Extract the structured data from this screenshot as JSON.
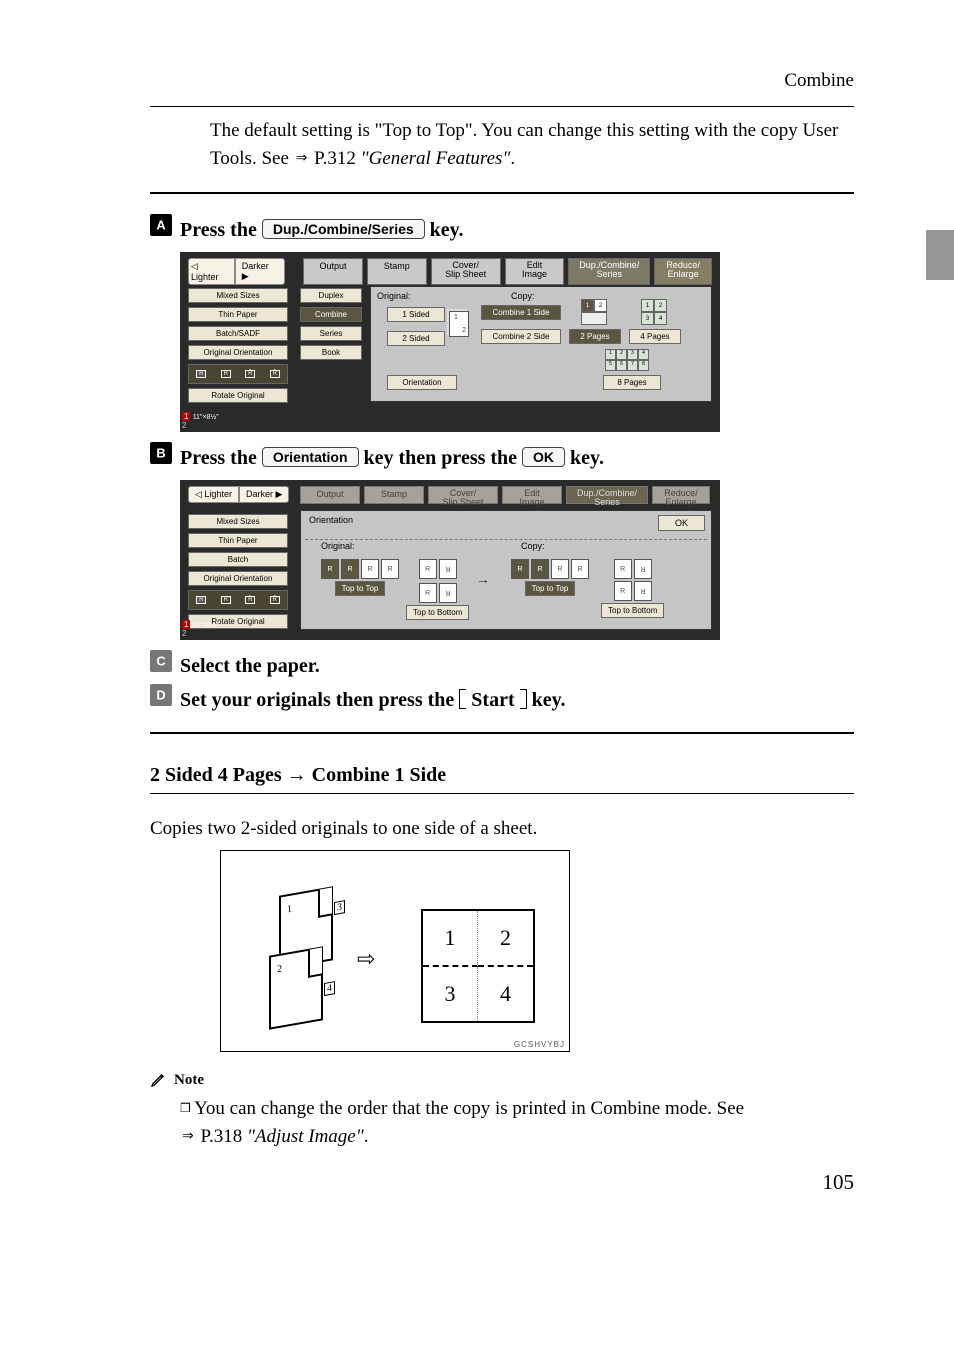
{
  "header_right": "Combine",
  "top_note": {
    "line1": "The default setting is \"Top to Top\". You can change this setting with the copy User Tools. See ",
    "ref_token": "⇒",
    "line1_after": " P.312 ",
    "line1_italic": "\"General Features\"",
    "line1_end": "."
  },
  "steps_stage1": {
    "a_pre": "Press the ",
    "a_btn": "Dup./Combine/Series",
    "a_post": " key.",
    "b_pre": "Press the ",
    "b_btn": "Orientation",
    "b_mid": " key then press the ",
    "b_btn2": "OK",
    "b_post": " key."
  },
  "ss1": {
    "lighter": "Lighter",
    "darker": "Darker",
    "row": {
      "output": "Output",
      "stamp": "Stamp",
      "cover": "Cover/\nSlip Sheet",
      "edit": "Edit\nImage",
      "dcs": "Dup./Combine/\nSeries",
      "reduce": "Reduce/\nEnlarge"
    },
    "left": {
      "mixed": "Mixed Sizes",
      "thin": "Thin Paper",
      "batch": "Batch/SADF",
      "orig": "Original Orientation",
      "rotate": "Rotate Original"
    },
    "mid": {
      "duplex": "Duplex",
      "combine": "Combine",
      "series": "Series",
      "book": "Book"
    },
    "right": {
      "orig_label": "Original:",
      "copy_label": "Copy:",
      "s1": "1 Sided",
      "s2": "2 Sided",
      "orientation": "Orientation",
      "c1": "Combine 1 Side",
      "c2": "Combine 2 Side",
      "p2": "2 Pages",
      "p4": "4 Pages",
      "p8": "8 Pages"
    },
    "footer": {
      "num": "1",
      "label": "11\"×8½\"",
      "extra": "2"
    }
  },
  "ss2": {
    "row": {
      "output": "Output",
      "stamp": "Stamp",
      "cover": "Cover/\nSlip Sheet",
      "edit": "Edit\nImage",
      "dcs": "Dup./Combine/\nSeries",
      "reduce": "Reduce/\nEnlarge"
    },
    "left": {
      "mixed": "Mixed Sizes",
      "thin": "Thin Paper",
      "batch": "Batch",
      "orig": "Original Orientation",
      "rotate": "Rotate Original"
    },
    "body": {
      "orientation_label": "Orientation",
      "original_label": "Original:",
      "copy_label": "Copy:",
      "ok": "OK",
      "tt": "Top to Top",
      "tb": "Top to Bottom"
    }
  },
  "steps_stage2": {
    "c": "Select the paper.",
    "d_pre": "Set your originals then press the ",
    "d_mid": "Start",
    "d_post": " key."
  },
  "section_heading": "2 Sided 4 Pages → Combine 1 Side",
  "section_body": "Copies two 2-sided originals to one side of a sheet.",
  "fig": {
    "n1": "1",
    "n2": "2",
    "n3": "3",
    "n4": "4",
    "q1": "1",
    "q2": "2",
    "q3": "3",
    "q4": "4",
    "code": "GCSHVYBJ"
  },
  "note_heading": "Note",
  "bottom_note": {
    "l1_pre": "You can change the order that the copy is printed in Combine mode. See ",
    "l1_ref": "⇒",
    "l1_mid": "P.318 ",
    "l1_italic": "\"Adjust Image\"",
    "l1_end": "."
  },
  "page_number": "105"
}
